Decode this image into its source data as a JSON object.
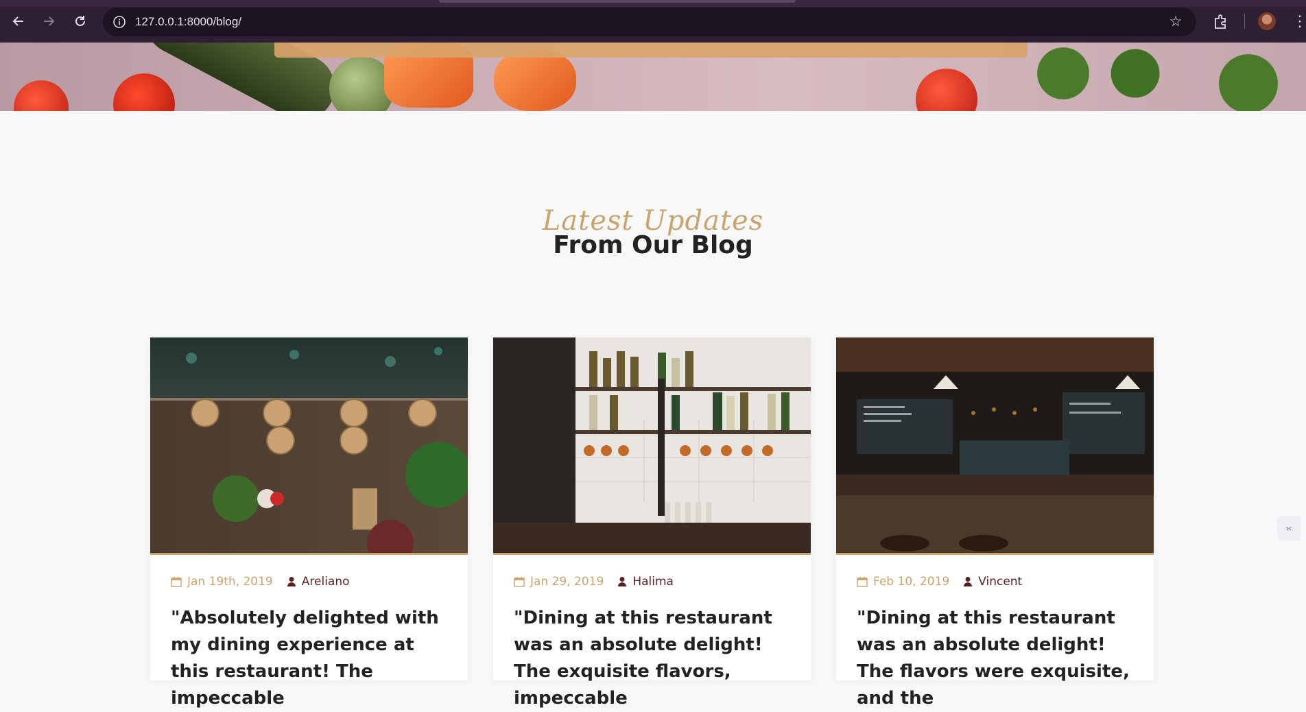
{
  "browser": {
    "url": "127.0.0.1:8000/blog/",
    "icons": {
      "back": "back-arrow-icon",
      "forward": "forward-arrow-icon",
      "reload": "reload-icon",
      "info": "info-icon",
      "bookmark": "star-icon",
      "extensions": "puzzle-icon",
      "menu": "kebab-menu-icon"
    }
  },
  "blog_section": {
    "script_title": "Latest Updates",
    "title": "From Our Blog"
  },
  "posts": [
    {
      "date": "Jan 19th, 2019",
      "author": "Areliano",
      "excerpt": "\"Absolutely delighted with my dining experience at this restaurant! The impeccable"
    },
    {
      "date": "Jan 29, 2019",
      "author": "Halima",
      "excerpt": "\"Dining at this restaurant was an absolute delight! The exquisite flavors, impeccable"
    },
    {
      "date": "Feb 10, 2019",
      "author": "Vincent",
      "excerpt": "\"Dining at this restaurant was an absolute delight! The flavors were exquisite, and the"
    }
  ],
  "colors": {
    "accent": "#c8a46e",
    "author": "#5a1f1f",
    "chrome_bg": "#2f1f35"
  }
}
